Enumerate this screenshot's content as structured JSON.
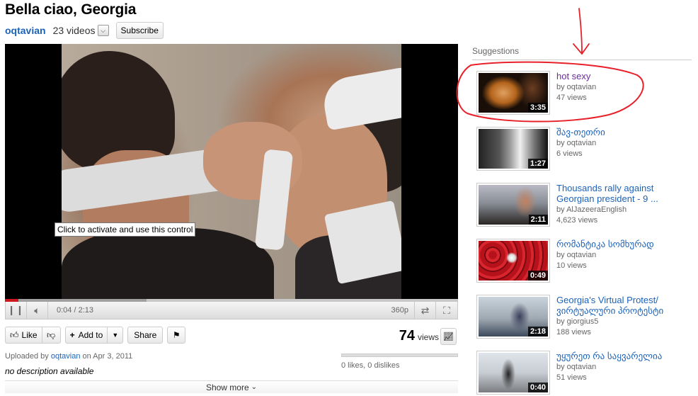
{
  "video": {
    "title": "Bella ciao, Georgia",
    "tooltip": "Click to activate and use this control",
    "progress_fraction": 0.03
  },
  "channel": {
    "name": "oqtavian",
    "video_count": "23 videos",
    "subscribe_label": "Subscribe"
  },
  "player_controls": {
    "time": "0:04 / 2:13",
    "quality": "360p",
    "play_pause_icon": "pause-icon",
    "volume_icon": "volume-icon",
    "loop_icon": "loop-icon",
    "fullscreen_icon": "fullscreen-icon"
  },
  "actions": {
    "like_label": "Like",
    "addto_label": "Add to",
    "share_label": "Share"
  },
  "stats": {
    "views_count": "74",
    "views_label": "views"
  },
  "upload": {
    "prefix": "Uploaded by",
    "user": "oqtavian",
    "date": "on Apr 3, 2011",
    "description": "no description available"
  },
  "ratings": {
    "text": "0 likes, 0 dislikes"
  },
  "show_more": "Show more",
  "suggestions": {
    "heading": "Suggestions",
    "items": [
      {
        "title": "hot sexy",
        "by": "by oqtavian",
        "views": "47 views",
        "duration": "3:35",
        "visited": true
      },
      {
        "title": "შავ-თეთრი",
        "by": "by oqtavian",
        "views": "6 views",
        "duration": "1:27",
        "visited": false
      },
      {
        "title": "Thousands rally against Georgian president - 9 ...",
        "by": "by AlJazeeraEnglish",
        "views": "4,623 views",
        "duration": "2:11",
        "visited": false
      },
      {
        "title": "რომანტიკა სომხურად",
        "by": "by oqtavian",
        "views": "10 views",
        "duration": "0:49",
        "visited": false
      },
      {
        "title": "Georgia's Virtual Protest/ ვირტუალური პროტესტი",
        "by": "by giorgius5",
        "views": "188 views",
        "duration": "2:18",
        "visited": false
      },
      {
        "title": "უყურეთ რა საყვარელია",
        "by": "by oqtavian",
        "views": "51 views",
        "duration": "0:40",
        "visited": false
      }
    ]
  },
  "colors": {
    "link": "#1c62b9",
    "visited_link": "#6d2e9c",
    "progress_played": "#cc181e",
    "annotation": "#e8202a"
  }
}
